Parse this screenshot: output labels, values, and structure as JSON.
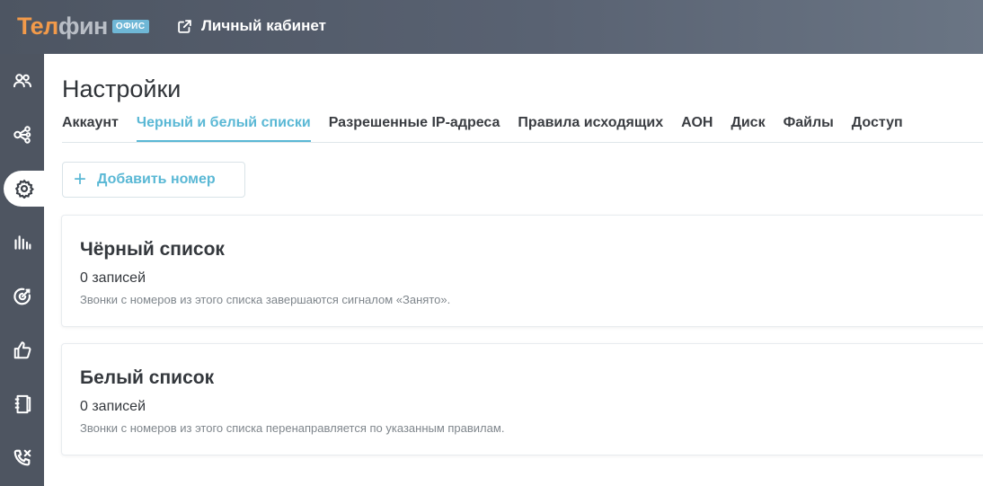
{
  "header": {
    "logo_primary": "Телфин",
    "logo_primary_part1": "Тел",
    "logo_primary_part2": "фин",
    "logo_badge": "ОФИС",
    "cabinet_link": "Личный кабинет"
  },
  "sidebar": {
    "items": [
      {
        "icon": "users-icon"
      },
      {
        "icon": "call-flow-icon"
      },
      {
        "icon": "settings-icon",
        "active": true
      },
      {
        "icon": "statistics-icon"
      },
      {
        "icon": "target-icon"
      },
      {
        "icon": "thumbs-up-icon"
      },
      {
        "icon": "notebook-icon"
      },
      {
        "icon": "missed-call-icon"
      }
    ]
  },
  "page": {
    "title": "Настройки",
    "tabs": [
      {
        "label": "Аккаунт"
      },
      {
        "label": "Черный и белый списки",
        "active": true
      },
      {
        "label": "Разрешенные IP-адреса"
      },
      {
        "label": "Правила исходящих"
      },
      {
        "label": "АОН"
      },
      {
        "label": "Диск"
      },
      {
        "label": "Файлы"
      },
      {
        "label": "Доступ"
      }
    ],
    "add_button": "Добавить номер",
    "black_list": {
      "title": "Чёрный список",
      "count": "0 записей",
      "description": "Звонки с номеров из этого списка завершаются сигналом «Занято»."
    },
    "white_list": {
      "title": "Белый список",
      "count": "0 записей",
      "description": "Звонки с номеров из этого списка перенаправляется по указанным правилам."
    }
  },
  "colors": {
    "accent": "#5ab8d5",
    "logo_orange": "#f29a4a",
    "sidebar_bg": "#4e5561"
  }
}
